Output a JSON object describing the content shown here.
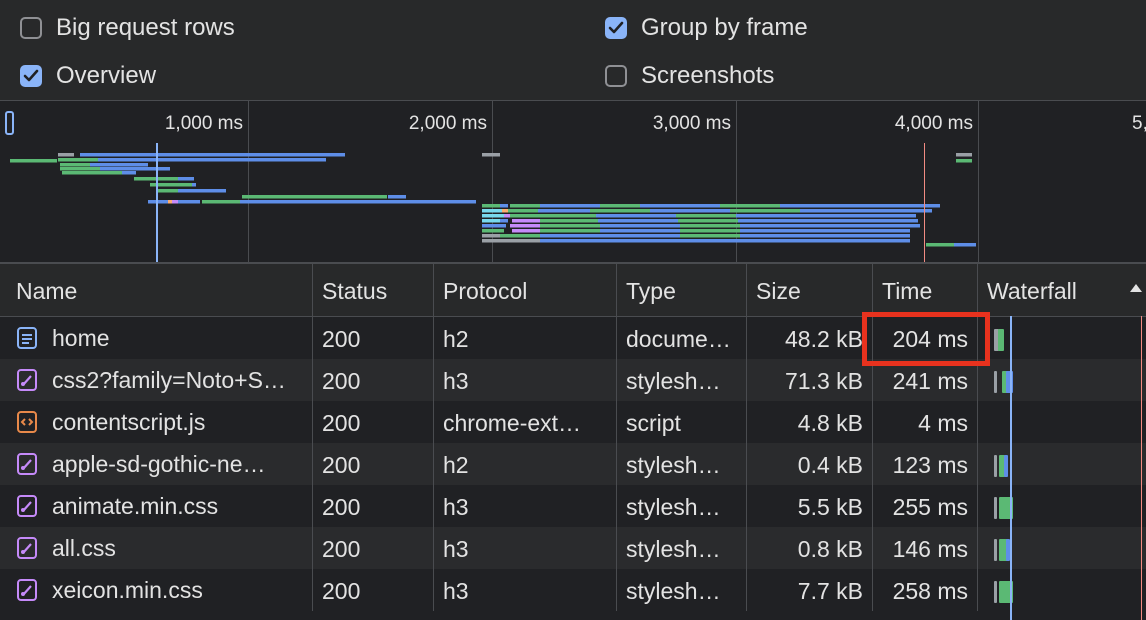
{
  "settings": {
    "big_request_rows": {
      "label": "Big request rows",
      "checked": false
    },
    "group_by_frame": {
      "label": "Group by frame",
      "checked": true
    },
    "overview": {
      "label": "Overview",
      "checked": true
    },
    "screenshots": {
      "label": "Screenshots",
      "checked": false
    }
  },
  "overview": {
    "ticks": [
      "1,000 ms",
      "2,000 ms",
      "3,000 ms",
      "4,000 ms",
      "5,"
    ]
  },
  "columns": {
    "name": "Name",
    "status": "Status",
    "protocol": "Protocol",
    "type": "Type",
    "size": "Size",
    "time": "Time",
    "waterfall": "Waterfall"
  },
  "rows": [
    {
      "name": "home",
      "icon": "document-icon",
      "status": "200",
      "protocol": "h2",
      "type": "docume…",
      "size": "48.2 kB",
      "time": "204 ms"
    },
    {
      "name": "css2?family=Noto+S…",
      "icon": "stylesheet-icon",
      "status": "200",
      "protocol": "h3",
      "type": "stylesh…",
      "size": "71.3 kB",
      "time": "241 ms"
    },
    {
      "name": "contentscript.js",
      "icon": "script-icon",
      "status": "200",
      "protocol": "chrome-ext…",
      "type": "script",
      "size": "4.8 kB",
      "time": "4 ms"
    },
    {
      "name": "apple-sd-gothic-ne…",
      "icon": "stylesheet-icon",
      "status": "200",
      "protocol": "h2",
      "type": "stylesh…",
      "size": "0.4 kB",
      "time": "123 ms"
    },
    {
      "name": "animate.min.css",
      "icon": "stylesheet-icon",
      "status": "200",
      "protocol": "h3",
      "type": "stylesh…",
      "size": "5.5 kB",
      "time": "255 ms"
    },
    {
      "name": "all.css",
      "icon": "stylesheet-icon",
      "status": "200",
      "protocol": "h3",
      "type": "stylesh…",
      "size": "0.8 kB",
      "time": "146 ms"
    },
    {
      "name": "xeicon.min.css",
      "icon": "stylesheet-icon",
      "status": "200",
      "protocol": "h3",
      "type": "stylesh…",
      "size": "7.7 kB",
      "time": "258 ms"
    }
  ],
  "colors": {
    "accent": "#8ab4f8",
    "highlight": "#e8321e",
    "waiting": "#5bb974",
    "download": "#5e8ee8",
    "stylesheet_icon": "#c58af9",
    "script_icon": "#e8894a",
    "document_icon": "#8ab4f8"
  }
}
